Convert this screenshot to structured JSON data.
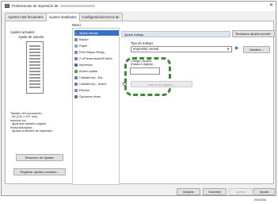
{
  "window": {
    "title": "Preferencias de impresión de",
    "close_glyph": "✕"
  },
  "tabs": [
    {
      "label": "Ajustes más frecuentes"
    },
    {
      "label": "Ajustes detallados"
    },
    {
      "label": "Configuración/Acerca de"
    }
  ],
  "left": {
    "current_settings_label": "Ajustes actuales",
    "current_settings_value": "Ajuste de usuario",
    "summary": [
      "Tamaño del documento:",
      "A4 (210 x 297 mm)",
      "Imprimir en:",
      "Igual que tamaño original",
      "Reducir/Ampliar:",
      "Ajustar a tamaño de impresión"
    ],
    "summary_button": "Resumen de ajustes",
    "register_button": "Registrar ajustes actuales..."
  },
  "menu": {
    "title": "Menú:",
    "items": [
      {
        "label": "Ajuste trabajo",
        "icon": "job-settings-icon",
        "color": "#5b7fc0"
      },
      {
        "label": "Básico",
        "icon": "basic-icon",
        "color": "#6e8fb8"
      },
      {
        "label": "Papel",
        "icon": "paper-icon",
        "color": "#8aa3c2"
      },
      {
        "label": "Perf./Separ./Desig.",
        "icon": "finishing-icon",
        "color": "#7a8ea8"
      },
      {
        "label": "2 c/Presentación/Folleto",
        "icon": "layout-icon",
        "color": "#6c85a6"
      },
      {
        "label": "Impresión",
        "icon": "print-quality-icon",
        "color": "#4f6b95"
      },
      {
        "label": "Ahorro salida",
        "icon": "eco-icon",
        "color": "#4d9a57"
      },
      {
        "label": "Calidad imp.: Est.",
        "icon": "quality-standard-icon",
        "color": "#6a7f9e"
      },
      {
        "label": "Calidad imp.: Avanz.",
        "icon": "quality-advanced-icon",
        "color": "#6a7f9e"
      },
      {
        "label": "Efectos",
        "icon": "effects-icon",
        "color": "#9a7fb0"
      },
      {
        "label": "Opciones driver",
        "icon": "driver-options-icon",
        "color": "#5a6f8a"
      }
    ]
  },
  "main": {
    "section_title": "Ajuste trabajo",
    "restore_button": "Restaurar ajustes predet.",
    "job_type_label": "Tipo de trabajo:",
    "job_type_value": "Impresión normal",
    "details_button": "Detalles...",
    "user_code_label_1": "Código usuario:",
    "user_code_label_2": "(Hasta 8 dígitos)",
    "user_code_value": "",
    "info_glyph": "i",
    "disabled_button": "Acerca de ajustes..."
  },
  "footer": {
    "ok": "Aceptar",
    "cancel": "Cancelar",
    "apply": "Aplicar",
    "help": "Ayuda"
  },
  "image_code": "EBW056"
}
